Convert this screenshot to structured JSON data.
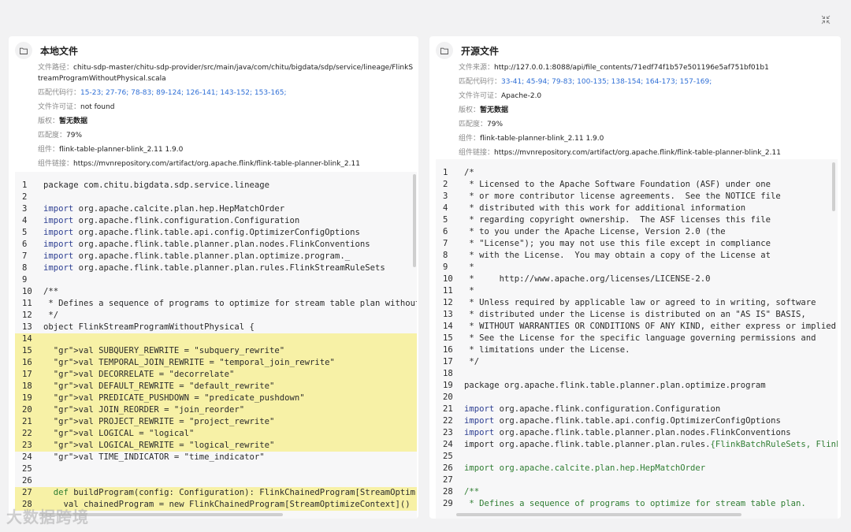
{
  "left": {
    "title": "本地文件",
    "meta": [
      {
        "k": "文件路径：",
        "v": "chitu-sdp-master/chitu-sdp-provider/src/main/java/com/chitu/bigdata/sdp/service/lineage/FlinkStreamProgramWithoutPhysical.scala",
        "style": "plain",
        "wrap": true
      },
      {
        "k": "匹配代码行：",
        "v": "15-23; 27-76; 78-83; 89-124; 126-141; 143-152; 153-165;",
        "style": "blue"
      },
      {
        "k": "文件许可证：",
        "v": "not found",
        "style": "plain"
      },
      {
        "k": "版权：",
        "v": "暂无数据",
        "style": "bold"
      },
      {
        "k": "匹配度：",
        "v": "79%",
        "style": "plain"
      },
      {
        "k": "组件：",
        "v": "flink-table-planner-blink_2.11 1.9.0",
        "style": "plain"
      },
      {
        "k": "组件链接：",
        "v": "https://mvnrepository.com/artifact/org.apache.flink/flink-table-planner-blink_2.11",
        "style": "plain"
      }
    ],
    "code": [
      {
        "n": "1",
        "t": "package com.chitu.bigdata.sdp.service.lineage",
        "c": "",
        "hl": false
      },
      {
        "n": "2",
        "t": "",
        "c": "",
        "hl": false
      },
      {
        "n": "3",
        "t": "import org.apache.calcite.plan.hep.HepMatchOrder",
        "c": "imp",
        "hl": false
      },
      {
        "n": "4",
        "t": "import org.apache.flink.configuration.Configuration",
        "c": "imp",
        "hl": false
      },
      {
        "n": "5",
        "t": "import org.apache.flink.table.api.config.OptimizerConfigOptions",
        "c": "imp",
        "hl": false
      },
      {
        "n": "6",
        "t": "import org.apache.flink.table.planner.plan.nodes.FlinkConventions",
        "c": "imp",
        "hl": false
      },
      {
        "n": "7",
        "t": "import org.apache.flink.table.planner.plan.optimize.program._",
        "c": "imp",
        "hl": false
      },
      {
        "n": "8",
        "t": "import org.apache.flink.table.planner.plan.rules.FlinkStreamRuleSets",
        "c": "imp",
        "hl": false
      },
      {
        "n": "9",
        "t": "",
        "c": "",
        "hl": false
      },
      {
        "n": "10",
        "t": "/**",
        "c": "",
        "hl": false
      },
      {
        "n": "11",
        "t": " * Defines a sequence of programs to optimize for stream table plan without",
        "c": "",
        "hl": false
      },
      {
        "n": "12",
        "t": " */",
        "c": "",
        "hl": false
      },
      {
        "n": "13",
        "t": "object FlinkStreamProgramWithoutPhysical {",
        "c": "",
        "hl": false
      },
      {
        "n": "14",
        "t": "",
        "c": "",
        "hl": true
      },
      {
        "n": "15",
        "t": "  val SUBQUERY_REWRITE = \"subquery_rewrite\"",
        "c": "val",
        "hl": true
      },
      {
        "n": "16",
        "t": "  val TEMPORAL_JOIN_REWRITE = \"temporal_join_rewrite\"",
        "c": "val",
        "hl": true
      },
      {
        "n": "17",
        "t": "  val DECORRELATE = \"decorrelate\"",
        "c": "val",
        "hl": true
      },
      {
        "n": "18",
        "t": "  val DEFAULT_REWRITE = \"default_rewrite\"",
        "c": "val",
        "hl": true
      },
      {
        "n": "19",
        "t": "  val PREDICATE_PUSHDOWN = \"predicate_pushdown\"",
        "c": "val",
        "hl": true
      },
      {
        "n": "20",
        "t": "  val JOIN_REORDER = \"join_reorder\"",
        "c": "val",
        "hl": true
      },
      {
        "n": "21",
        "t": "  val PROJECT_REWRITE = \"project_rewrite\"",
        "c": "val",
        "hl": true
      },
      {
        "n": "22",
        "t": "  val LOGICAL = \"logical\"",
        "c": "val",
        "hl": true
      },
      {
        "n": "23",
        "t": "  val LOGICAL_REWRITE = \"logical_rewrite\"",
        "c": "val",
        "hl": true
      },
      {
        "n": "24",
        "t": "  val TIME_INDICATOR = \"time_indicator\"",
        "c": "val",
        "hl": false
      },
      {
        "n": "25",
        "t": "",
        "c": "",
        "hl": false
      },
      {
        "n": "26",
        "t": "",
        "c": "",
        "hl": false
      },
      {
        "n": "27",
        "t": "  def buildProgram(config: Configuration): FlinkChainedProgram[StreamOptim",
        "c": "def",
        "hl": true
      },
      {
        "n": "28",
        "t": "    val chainedProgram = new FlinkChainedProgram[StreamOptimizeContext]()",
        "c": "",
        "hl": true
      }
    ]
  },
  "right": {
    "title": "开源文件",
    "meta": [
      {
        "k": "文件来源：",
        "v": "http://127.0.0.1:8088/api/file_contents/71edf74f1b57e501196e5af751bf01b1",
        "style": "plain"
      },
      {
        "k": "匹配代码行：",
        "v": "33-41; 45-94; 79-83; 100-135; 138-154; 164-173; 157-169;",
        "style": "blue"
      },
      {
        "k": "文件许可证：",
        "v": "Apache-2.0",
        "style": "plain"
      },
      {
        "k": "版权：",
        "v": "暂无数据",
        "style": "bold"
      },
      {
        "k": "匹配度：",
        "v": "79%",
        "style": "plain"
      },
      {
        "k": "组件：",
        "v": "flink-table-planner-blink_2.11 1.9.0",
        "style": "plain"
      },
      {
        "k": "组件链接：",
        "v": "https://mvnrepository.com/artifact/org.apache.flink/flink-table-planner-blink_2.11",
        "style": "plain"
      }
    ],
    "code": [
      {
        "n": "1",
        "t": "/*",
        "c": "",
        "hl": false
      },
      {
        "n": "2",
        "t": " * Licensed to the Apache Software Foundation (ASF) under one",
        "c": "",
        "hl": false
      },
      {
        "n": "3",
        "t": " * or more contributor license agreements.  See the NOTICE file",
        "c": "",
        "hl": false
      },
      {
        "n": "4",
        "t": " * distributed with this work for additional information",
        "c": "",
        "hl": false
      },
      {
        "n": "5",
        "t": " * regarding copyright ownership.  The ASF licenses this file",
        "c": "",
        "hl": false
      },
      {
        "n": "6",
        "t": " * to you under the Apache License, Version 2.0 (the",
        "c": "",
        "hl": false
      },
      {
        "n": "7",
        "t": " * \"License\"); you may not use this file except in compliance",
        "c": "",
        "hl": false
      },
      {
        "n": "8",
        "t": " * with the License.  You may obtain a copy of the License at",
        "c": "",
        "hl": false
      },
      {
        "n": "9",
        "t": " *",
        "c": "",
        "hl": false
      },
      {
        "n": "10",
        "t": " *     http://www.apache.org/licenses/LICENSE-2.0",
        "c": "",
        "hl": false
      },
      {
        "n": "11",
        "t": " *",
        "c": "",
        "hl": false
      },
      {
        "n": "12",
        "t": " * Unless required by applicable law or agreed to in writing, software",
        "c": "",
        "hl": false
      },
      {
        "n": "13",
        "t": " * distributed under the License is distributed on an \"AS IS\" BASIS,",
        "c": "",
        "hl": false
      },
      {
        "n": "14",
        "t": " * WITHOUT WARRANTIES OR CONDITIONS OF ANY KIND, either express or implied",
        "c": "",
        "hl": false
      },
      {
        "n": "15",
        "t": " * See the License for the specific language governing permissions and",
        "c": "",
        "hl": false
      },
      {
        "n": "16",
        "t": " * limitations under the License.",
        "c": "",
        "hl": false
      },
      {
        "n": "17",
        "t": " */",
        "c": "",
        "hl": false
      },
      {
        "n": "18",
        "t": "",
        "c": "",
        "hl": false
      },
      {
        "n": "19",
        "t": "package org.apache.flink.table.planner.plan.optimize.program",
        "c": "",
        "hl": false
      },
      {
        "n": "20",
        "t": "",
        "c": "",
        "hl": false
      },
      {
        "n": "21",
        "t": "import org.apache.flink.configuration.Configuration",
        "c": "imp",
        "hl": false
      },
      {
        "n": "22",
        "t": "import org.apache.flink.table.api.config.OptimizerConfigOptions",
        "c": "imp",
        "hl": false
      },
      {
        "n": "23",
        "t": "import org.apache.flink.table.planner.plan.nodes.FlinkConventions",
        "c": "imp",
        "hl": false
      },
      {
        "n": "24",
        "t": "import org.apache.flink.table.planner.plan.rules.{FlinkBatchRuleSets, FlinkS",
        "c": "imp2",
        "hl": false
      },
      {
        "n": "25",
        "t": "",
        "c": "",
        "hl": false
      },
      {
        "n": "26",
        "t": "import org.apache.calcite.plan.hep.HepMatchOrder",
        "c": "green",
        "hl": false
      },
      {
        "n": "27",
        "t": "",
        "c": "",
        "hl": false
      },
      {
        "n": "28",
        "t": "/**",
        "c": "green",
        "hl": false
      },
      {
        "n": "29",
        "t": " * Defines a sequence of programs to optimize for stream table plan.",
        "c": "green",
        "hl": false
      }
    ]
  },
  "watermark": "大数据跨境",
  "icons": {
    "close": "collapse-icon",
    "folder": "folder-icon"
  }
}
